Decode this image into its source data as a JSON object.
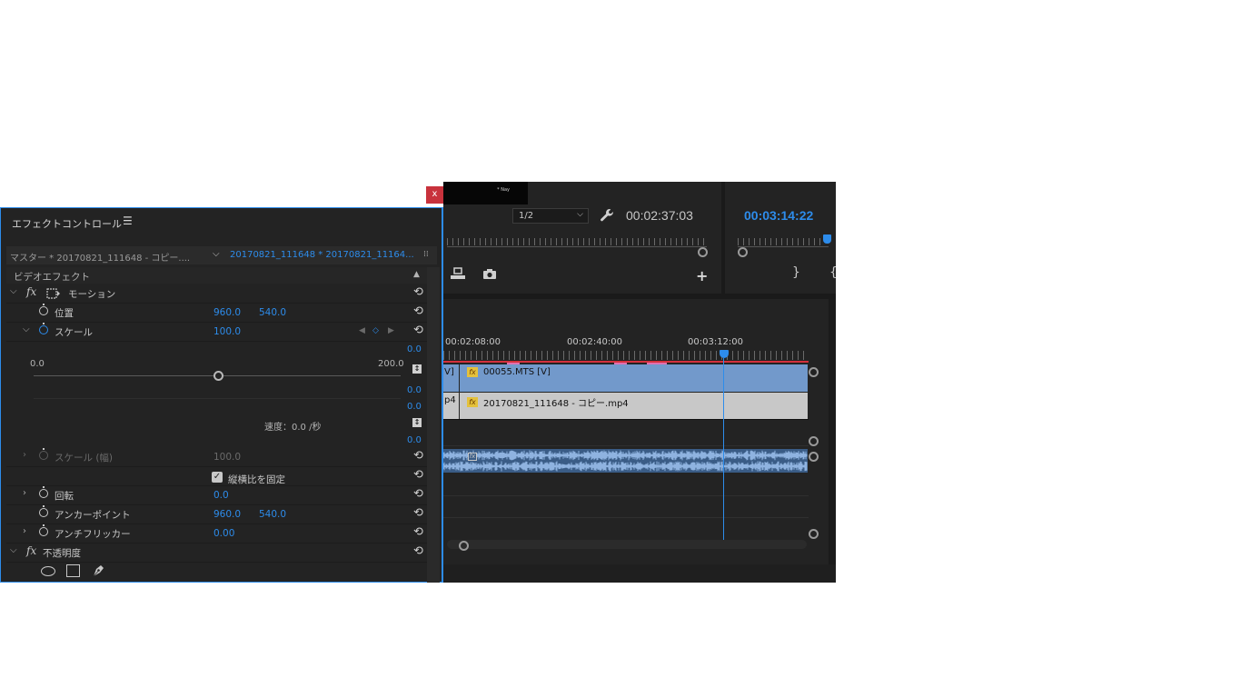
{
  "program_monitor": {
    "resolution": "1/2",
    "timecode_left": "00:02:37:03",
    "timecode_right": "00:03:14:22",
    "thumb_watermark": "* Nay"
  },
  "timeline": {
    "ruler_labels": [
      "00:02:08:00",
      "00:02:40:00",
      "00:03:12:00"
    ],
    "clip_v2_left": "V]",
    "clip_v2_name": "00055.MTS [V]",
    "clip_v1_left": "p4",
    "clip_v1_name": "20170821_111648  - コピー.mp4",
    "fx_badge": "fx",
    "colors": {
      "video_clip": "#7299cb",
      "audio_clip": "#3a5c86",
      "playhead": "#2d8ceb",
      "work_area": "#d4303c"
    }
  },
  "effect_controls": {
    "close_label": "x",
    "title": "エフェクトコントロール",
    "menu_glyph": "☰",
    "source_master": "マスター * 20170821_111648 - コピー....",
    "source_clip": "20170821_111648 * 20170821_11164...",
    "section_video": "ビデオエフェクト",
    "motion": "モーション",
    "position": {
      "label": "位置",
      "x": "960.0",
      "y": "540.0"
    },
    "scale": {
      "label": "スケール",
      "value": "100.0"
    },
    "scale_graph": {
      "top_value": "0.0",
      "min": "0.0",
      "max": "200.0",
      "v1": "0.0",
      "v2": "0.0",
      "speed": "速度：0.0 /秒",
      "v3": "0.0"
    },
    "scale_width": {
      "label": "スケール (幅)",
      "value": "100.0"
    },
    "uniform_scale": "縦横比を固定",
    "rotation": {
      "label": "回転",
      "value": "0.0"
    },
    "anchor": {
      "label": "アンカーポイント",
      "x": "960.0",
      "y": "540.0"
    },
    "antiflicker": {
      "label": "アンチフリッカー",
      "value": "0.00"
    },
    "opacity": "不透明度",
    "fx_glyph": "fx"
  }
}
